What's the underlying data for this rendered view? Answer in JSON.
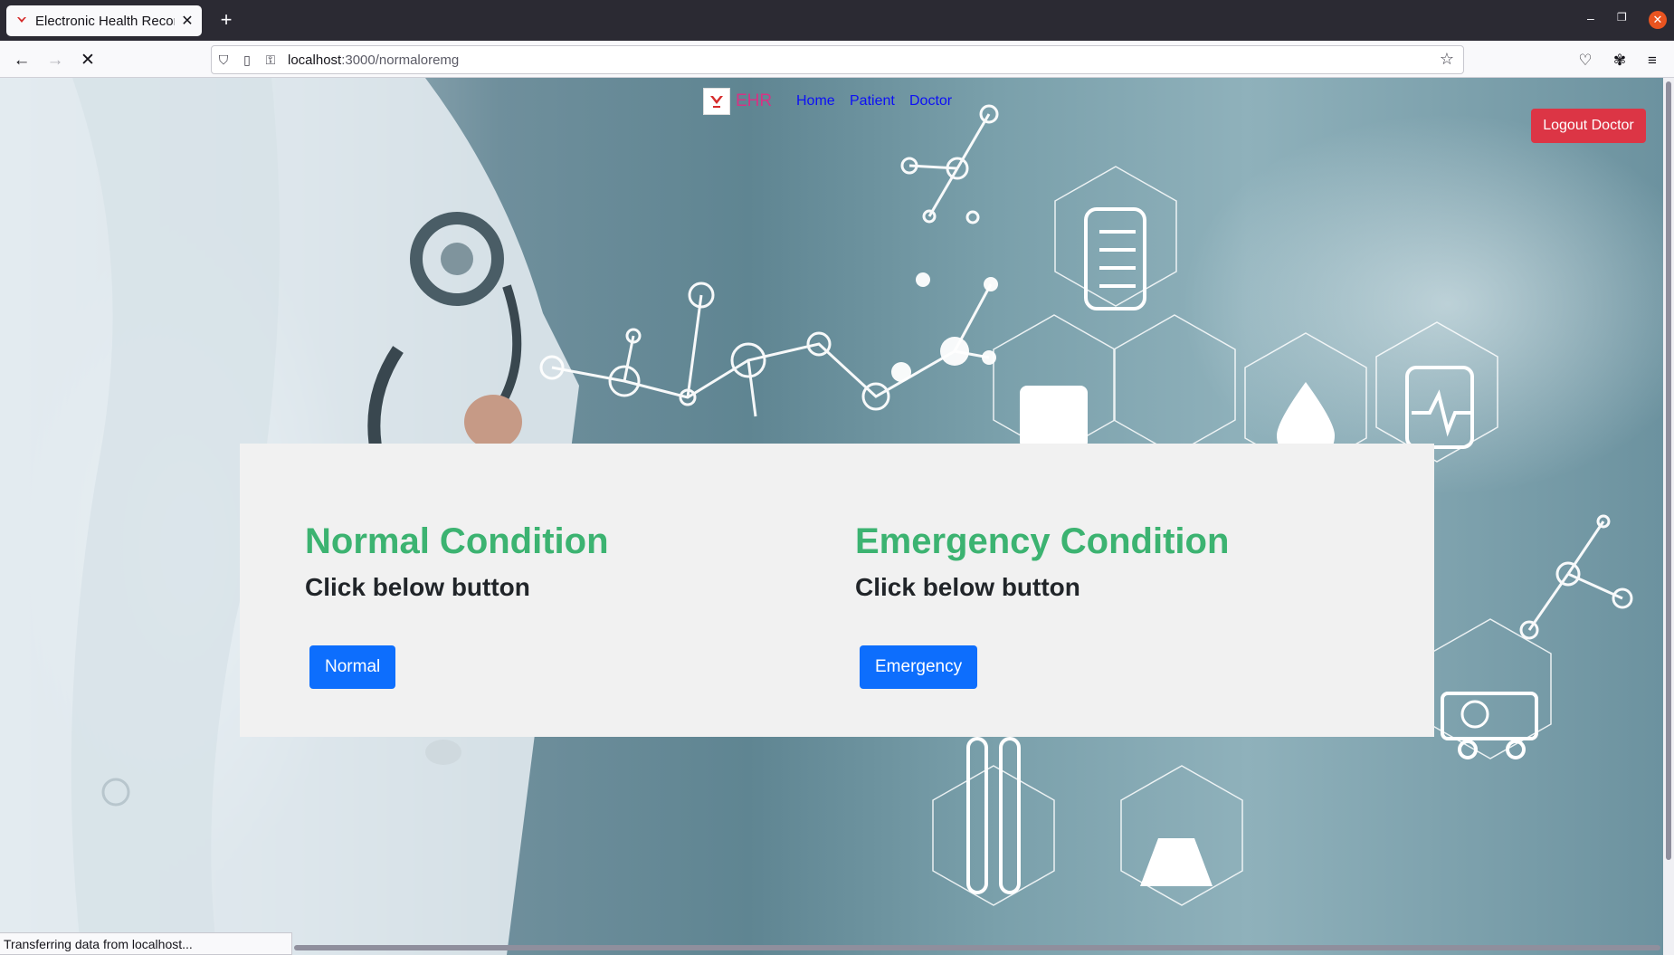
{
  "browser": {
    "tab_title": "Electronic Health Record",
    "url_host": "localhost",
    "url_rest": ":3000/normaloremg",
    "status_text": "Transferring data from localhost..."
  },
  "site": {
    "brand": "EHR",
    "nav": [
      "Home",
      "Patient",
      "Doctor"
    ],
    "logout_label": "Logout Doctor"
  },
  "main": {
    "normal": {
      "heading": "Normal Condition",
      "subheading": "Click below button",
      "button": "Normal"
    },
    "emergency": {
      "heading": "Emergency Condition",
      "subheading": "Click below button",
      "button": "Emergency"
    }
  },
  "colors": {
    "heading_green": "#3cb371",
    "primary_blue": "#0d6efd",
    "danger_red": "#dc3545",
    "brand_pink": "#d63384"
  }
}
